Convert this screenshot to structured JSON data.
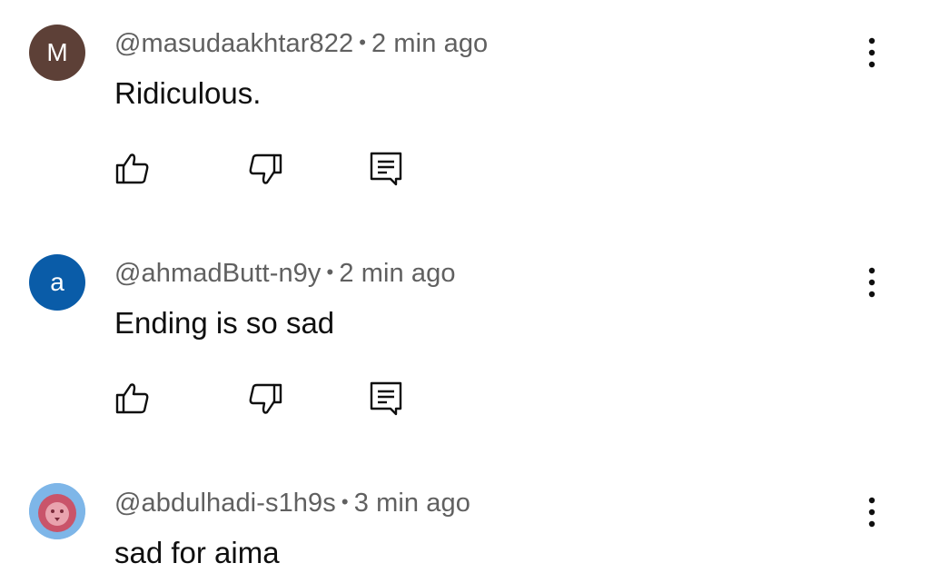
{
  "comments": [
    {
      "avatar": {
        "letter": "M",
        "color": "#5d4037"
      },
      "author": "@masudaakhtar822",
      "separator": "•",
      "time": "2 min ago",
      "text": "Ridiculous.",
      "icons": {
        "like": "thumb-up-icon",
        "dislike": "thumb-down-icon",
        "reply": "reply-icon",
        "menu": "more-vertical-icon"
      }
    },
    {
      "avatar": {
        "letter": "a",
        "color": "#0a5ca8"
      },
      "author": "@ahmadButt-n9y",
      "separator": "•",
      "time": "2 min ago",
      "text": "Ending is so sad",
      "icons": {
        "like": "thumb-up-icon",
        "dislike": "thumb-down-icon",
        "reply": "reply-icon",
        "menu": "more-vertical-icon"
      }
    },
    {
      "avatar": {
        "letter": "",
        "image": "lion-avatar",
        "color": "#7eb6e8"
      },
      "author": "@abdulhadi-s1h9s",
      "separator": "•",
      "time": "3 min ago",
      "text": "sad for aima",
      "icons": {
        "menu": "more-vertical-icon"
      }
    }
  ]
}
